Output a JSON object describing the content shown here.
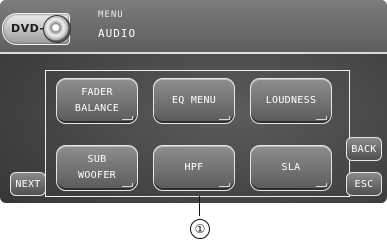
{
  "header": {
    "source_label": "DVD-V",
    "title": "MENU",
    "subtitle": "AUDIO",
    "disc_icon": "disc-icon"
  },
  "menu_buttons": [
    {
      "label": "FADER\nBALANCE"
    },
    {
      "label": "EQ MENU"
    },
    {
      "label": "LOUDNESS"
    },
    {
      "label": "SUB\nWOOFER"
    },
    {
      "label": "HPF"
    },
    {
      "label": "SLA"
    }
  ],
  "side_buttons": {
    "next": "NEXT",
    "back": "BACK",
    "esc": "ESC"
  },
  "callout": "①",
  "colors": {
    "screen_bg": "#454545",
    "button_border": "#e6e6e6",
    "text": "#ffffff"
  }
}
